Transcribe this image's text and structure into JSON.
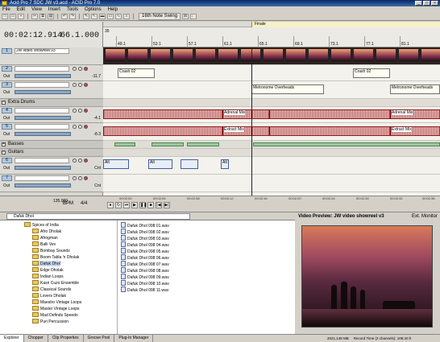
{
  "window": {
    "title": "Acid Pro 7 SDC JW v3.acd - ACID Pro 7.0",
    "controls": [
      "_",
      "□",
      "×"
    ]
  },
  "menu": [
    "File",
    "Edit",
    "View",
    "Insert",
    "Tools",
    "Options",
    "Help"
  ],
  "toolbar": {
    "swing_label": "16th Note Swing"
  },
  "time": {
    "position": "00:02:12.914",
    "beat": "66.1.000"
  },
  "ruler": {
    "marker_label": "Finale",
    "marker_number": "35",
    "ticks": [
      "49.1",
      "53.1",
      "57.1",
      "61.1",
      "65.1",
      "69.1",
      "73.1",
      "77.1",
      "81.1"
    ]
  },
  "tracks": [
    {
      "kind": "video",
      "number": "1",
      "name": "JW video showreel v3"
    },
    {
      "kind": "audio",
      "number": "2",
      "name": "",
      "out": "Out",
      "value": "-11.7"
    },
    {
      "kind": "audio",
      "number": "3",
      "name": "",
      "out": "Out",
      "value": ""
    },
    {
      "kind": "folder",
      "name": "Extra Drums"
    },
    {
      "kind": "audio",
      "number": "4",
      "name": "",
      "out": "Out",
      "value": "-4.1"
    },
    {
      "kind": "audio",
      "number": "5",
      "name": "",
      "out": "Out",
      "value": "-8.3"
    },
    {
      "kind": "folder",
      "name": "Basses"
    },
    {
      "kind": "folder",
      "name": "Guitars"
    },
    {
      "kind": "audio",
      "number": "6",
      "name": "",
      "out": "Out",
      "value": "Cnt"
    },
    {
      "kind": "audio",
      "number": "7",
      "name": "",
      "out": "Out",
      "value": "Cnt"
    }
  ],
  "clips": {
    "crash1": "Crash 02",
    "crash2": "Crash 02",
    "metronome": "Metronome Overheads",
    "metronome2": "Metronome Overheads",
    "adrenal": "Adrenal Mix",
    "adrenal2": "Adrenal Mix",
    "extract": "Extract Mix",
    "extract2": "Extract Mix",
    "sax1": "Alt",
    "sax2": "Alt",
    "sax3": "Alt"
  },
  "transport": {
    "tempo": "135.000",
    "bpm": "BPM",
    "time_sig": "4/4",
    "unit": ""
  },
  "bottom_ruler": [
    "00:02:00",
    "00:02:04",
    "00:02:08",
    "00:02:12",
    "00:02:16",
    "00:02:20",
    "00:02:24",
    "00:02:28",
    "00:02:32",
    "00:02:36"
  ],
  "explorer": {
    "path": "Dafuk Dhol",
    "tree": [
      "Spices of India",
      "Afro Dholak",
      "Afrogman",
      "Balli Vev",
      "Bombay Soundz",
      "Boom Tabla 'n Dholak",
      "Dafuk Dhol",
      "Edge Dholak",
      "Indian Loops",
      "Kasri Cuzo Ensemble",
      "Classical Sounds",
      "Lovers Dholak",
      "Maestro Vintage Loops",
      "Master Vintage Loops",
      "Mad Definds Speedo",
      "Puri Percussion"
    ],
    "files": [
      "Dafuk Dhol 098 01.wav",
      "Dafuk Dhol 098 02.wav",
      "Dafuk Dhol 098 03.wav",
      "Dafuk Dhol 098 04.wav",
      "Dafuk Dhol 098 05.wav",
      "Dafuk Dhol 098 06.wav",
      "Dafuk Dhol 098 07.wav",
      "Dafuk Dhol 098 08.wav",
      "Dafuk Dhol 098 09.wav",
      "Dafuk Dhol 098 10.wav",
      "Dafuk Dhol 098 11.wav"
    ],
    "tabs": [
      "Explorer",
      "Chopper",
      "Clip Properties",
      "Groove Pool",
      "Plug-In Manager"
    ]
  },
  "video": {
    "title": "Video Preview: JW video showreel v3",
    "ext_monitor": "Ext. Monitor",
    "status": [
      "2021,148 MB",
      "Record Time (2 channels): 106:40 h"
    ]
  }
}
